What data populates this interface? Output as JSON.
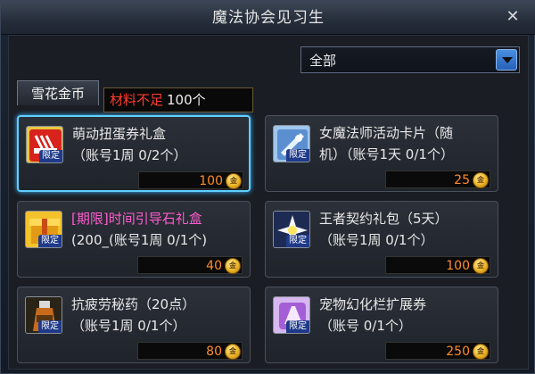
{
  "window": {
    "title": "魔法协会见习生",
    "close_label": "✕"
  },
  "filter": {
    "selected": "全部"
  },
  "tab": {
    "label": "雪花金币"
  },
  "tooltip": {
    "warning": "材料不足",
    "quantity": "100个"
  },
  "currency_icon": "gold-coin-icon",
  "items": [
    {
      "name": "萌动扭蛋券礼盒",
      "sub": "（账号1周 0/2个）",
      "price": "100",
      "tag": "限定",
      "icon": "gacha-ticket-box-icon",
      "name_color": "#e8e8e8",
      "selected": true
    },
    {
      "name": "女魔法师活动卡片（随",
      "sub": "机）（账号1天 0/1个）",
      "price": "25",
      "tag": "限定",
      "icon": "event-card-icon",
      "name_color": "#e8e8e8",
      "selected": false
    },
    {
      "name": "[期限]时间引导石礼盒",
      "sub": "(200_(账号1周 0/1个)",
      "price": "40",
      "tag": "限定",
      "icon": "guide-stone-box-icon",
      "name_color": "#ff5ccd",
      "selected": false
    },
    {
      "name": "王者契约礼包（5天）",
      "sub": "（账号1周 0/1个）",
      "price": "100",
      "tag": "限定",
      "icon": "contract-pack-icon",
      "name_color": "#e8e8e8",
      "selected": false
    },
    {
      "name": "抗疲劳秘药（20点）",
      "sub": "（账号1周 0/1个）",
      "price": "80",
      "tag": "限定",
      "icon": "potion-icon",
      "name_color": "#e8e8e8",
      "selected": false
    },
    {
      "name": "宠物幻化栏扩展券",
      "sub": "（账号 0/1个）",
      "price": "250",
      "tag": "限定",
      "icon": "pet-slot-ticket-icon",
      "name_color": "#e8e8e8",
      "selected": false
    }
  ]
}
